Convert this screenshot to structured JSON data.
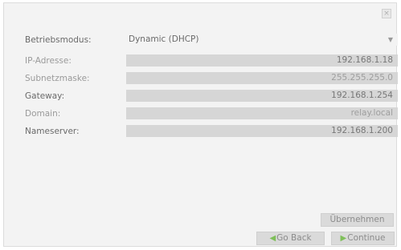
{
  "dialog": {
    "close_glyph": "×"
  },
  "form": {
    "mode": {
      "label": "Betriebsmodus:",
      "value": "Dynamic (DHCP)"
    },
    "fields": [
      {
        "label": "IP-Adresse:",
        "value": "192.168.1.18"
      },
      {
        "label": "Subnetzmaske:",
        "value": "255.255.255.0"
      },
      {
        "label": "Gateway:",
        "value": "192.168.1.254"
      },
      {
        "label": "Domain:",
        "value": "relay.local"
      },
      {
        "label": "Nameserver:",
        "value": "192.168.1.200"
      }
    ]
  },
  "buttons": {
    "apply": "Übernehmen",
    "back": "Go Back",
    "continue": "Continue"
  },
  "icons": {
    "back": "arrow-left-icon",
    "continue": "arrow-right-icon",
    "dropdown": "chevron-down-icon"
  }
}
